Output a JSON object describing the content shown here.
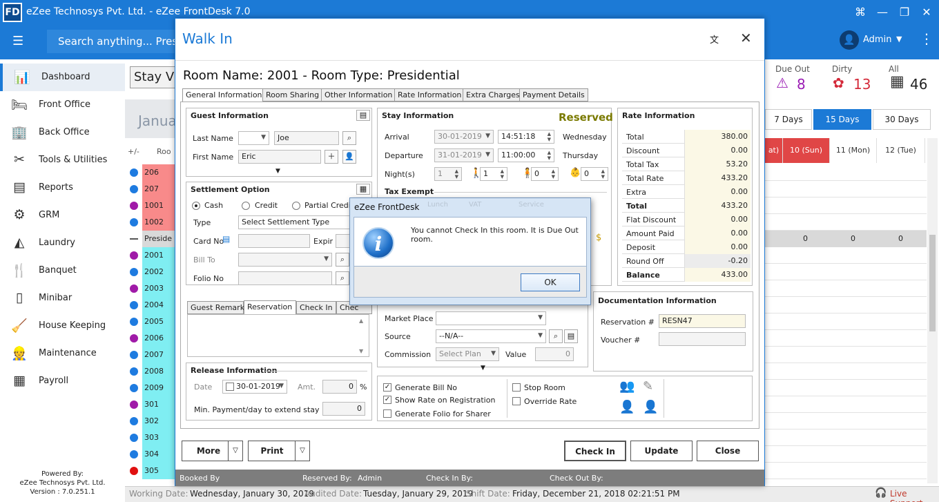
{
  "app": {
    "logo": "FD",
    "title": "eZee Technosys Pvt. Ltd. - eZee FrontDesk 7.0"
  },
  "topbar": {
    "search_placeholder": "Search anything... Press",
    "user": "Admin"
  },
  "sidebar": {
    "items": [
      {
        "label": "Dashboard",
        "icon": "chart-icon"
      },
      {
        "label": "Front Office",
        "icon": "bed-icon"
      },
      {
        "label": "Back Office",
        "icon": "building-icon"
      },
      {
        "label": "Tools & Utilities",
        "icon": "tools-icon"
      },
      {
        "label": "Reports",
        "icon": "report-icon"
      },
      {
        "label": "GRM",
        "icon": "grm-icon"
      },
      {
        "label": "Laundry",
        "icon": "iron-icon"
      },
      {
        "label": "Banquet",
        "icon": "cutlery-icon"
      },
      {
        "label": "Minibar",
        "icon": "fridge-icon"
      },
      {
        "label": "House Keeping",
        "icon": "broom-icon"
      },
      {
        "label": "Maintenance",
        "icon": "worker-icon"
      },
      {
        "label": "Payroll",
        "icon": "payroll-icon"
      }
    ],
    "powered": [
      "Powered By:",
      "eZee Technosys Pvt. Ltd.",
      "Version : 7.0.251.1"
    ]
  },
  "background": {
    "stay_view": "Stay Vie",
    "month": "Janua",
    "col_plusminus": "+/-",
    "col_room": "Roo",
    "stats": [
      {
        "label": "Due Out",
        "value": "8"
      },
      {
        "label": "Dirty",
        "value": "13"
      },
      {
        "label": "All",
        "value": "46"
      }
    ],
    "day_buttons": [
      "7 Days",
      "15 Days",
      "30 Days"
    ],
    "day_heads": [
      "at)",
      "10 (Sun)",
      "11 (Mon)",
      "12 (Tue)"
    ],
    "zero_row": [
      "0",
      "0",
      "0"
    ],
    "rooms": [
      {
        "num": "206",
        "dot": "#1e7be0",
        "bg": "#f88a8a"
      },
      {
        "num": "207",
        "dot": "#1e7be0",
        "bg": "#f88a8a"
      },
      {
        "num": "1001",
        "dot": "#a01aa8",
        "bg": "#f88a8a"
      },
      {
        "num": "1002",
        "dot": "#1e7be0",
        "bg": "#f88a8a"
      },
      {
        "num": "Preside",
        "dot": "",
        "bg": "#d9d9d9"
      },
      {
        "num": "2001",
        "dot": "#a01aa8",
        "bg": "#7feef2"
      },
      {
        "num": "2002",
        "dot": "#1e7be0",
        "bg": "#7feef2"
      },
      {
        "num": "2003",
        "dot": "#a01aa8",
        "bg": "#7feef2"
      },
      {
        "num": "2004",
        "dot": "#1e7be0",
        "bg": "#7feef2"
      },
      {
        "num": "2005",
        "dot": "#1e7be0",
        "bg": "#7feef2"
      },
      {
        "num": "2006",
        "dot": "#a01aa8",
        "bg": "#7feef2"
      },
      {
        "num": "2007",
        "dot": "#1e7be0",
        "bg": "#7feef2"
      },
      {
        "num": "2008",
        "dot": "#1e7be0",
        "bg": "#7feef2"
      },
      {
        "num": "2009",
        "dot": "#1e7be0",
        "bg": "#7feef2"
      },
      {
        "num": "301",
        "dot": "#a01aa8",
        "bg": "#7feef2"
      },
      {
        "num": "302",
        "dot": "#1e7be0",
        "bg": "#7feef2"
      },
      {
        "num": "303",
        "dot": "#1e7be0",
        "bg": "#7feef2"
      },
      {
        "num": "304",
        "dot": "#1e7be0",
        "bg": "#7feef2"
      },
      {
        "num": "305",
        "dot": "#e01010",
        "bg": "#7feef2"
      }
    ]
  },
  "status": {
    "working_label": "Working Date:",
    "working": "Wednesday, January 30, 2019",
    "audited_label": "Audited Date:",
    "audited": "Tuesday, January 29, 2019",
    "shift_label": "Shift Date:",
    "shift": "Friday, December 21, 2018 02:21:51 PM",
    "live_support": "Live Support"
  },
  "walkin": {
    "title": "Walk In",
    "room_name": "Room Name: 2001 - Room Type: Presidential",
    "tabs": [
      "General Information",
      "Room Sharing",
      "Other Information",
      "Rate Information",
      "Extra Charges",
      "Payment Details"
    ],
    "guest": {
      "header": "Guest Information",
      "last_name_label": "Last Name",
      "last_name": "Joe",
      "first_name_label": "First Name",
      "first_name": "Eric"
    },
    "settlement": {
      "header": "Settlement Option",
      "cash": "Cash",
      "credit": "Credit",
      "partial": "Partial Credit",
      "type_label": "Type",
      "type_value": "Select Settlement Type",
      "card_label": "Card No",
      "expiry_label": "Expir",
      "bill_to_label": "Bill To",
      "folio_label": "Folio No"
    },
    "remark_tabs": [
      "Guest Remark",
      "Reservation",
      "Check In",
      "Chec"
    ],
    "release": {
      "header": "Release Information",
      "date_label": "Date",
      "date": "30-01-2019",
      "amt_label": "Amt.",
      "amt": "0",
      "pct": "%",
      "min_label": "Min. Payment/day to extend stay",
      "min_val": "0"
    },
    "stay": {
      "header": "Stay Information",
      "status": "Reserved",
      "arrival_label": "Arrival",
      "arrival_date": "30-01-2019",
      "arrival_time": "14:51:18",
      "arrival_day": "Wednesday",
      "departure_label": "Departure",
      "departure_date": "31-01-2019",
      "departure_time": "11:00:00",
      "departure_day": "Thursday",
      "nights_label": "Night(s)",
      "nights": "1",
      "adults": "1",
      "children": "0",
      "infants": "0",
      "tax_exempt": "Tax Exempt"
    },
    "market": {
      "market_label": "Market Place",
      "source_label": "Source",
      "source": "--N/A--",
      "commission_label": "Commission",
      "commission": "Select Plan",
      "value_label": "Value",
      "value": "0"
    },
    "rate": {
      "header": "Rate Information",
      "rows": [
        {
          "label": "Total",
          "value": "380.00"
        },
        {
          "label": "Discount",
          "value": "0.00"
        },
        {
          "label": "Total Tax",
          "value": "53.20"
        },
        {
          "label": "Total Rate",
          "value": "433.20"
        },
        {
          "label": "Extra",
          "value": "0.00"
        },
        {
          "label": "Total",
          "value": "433.20"
        },
        {
          "label": "Flat Discount",
          "value": "0.00"
        },
        {
          "label": "Amount Paid",
          "value": "0.00"
        },
        {
          "label": "Deposit",
          "value": "0.00"
        },
        {
          "label": "Round Off",
          "value": "-0.20"
        },
        {
          "label": "Balance",
          "value": "433.00"
        }
      ]
    },
    "documentation": {
      "header": "Documentation Information",
      "reservation_label": "Reservation #",
      "reservation": "RESN47",
      "voucher_label": "Voucher #"
    },
    "options": {
      "generate_bill": "Generate Bill No",
      "show_rate": "Show Rate on Registration",
      "generate_folio": "Generate Folio for Sharer",
      "stop_room": "Stop Room",
      "override_rate": "Override Rate"
    },
    "buttons": {
      "more": "More",
      "print": "Print",
      "check_in": "Check In",
      "update": "Update",
      "close": "Close"
    },
    "footer": {
      "booked_by": "Booked By",
      "reserved_by": "Reserved By:",
      "reserved_by_value": "Admin",
      "check_in_by": "Check In By:",
      "check_out_by": "Check Out By:"
    }
  },
  "msgbox": {
    "title": "eZee FrontDesk",
    "message": "You cannot Check In this room. It is Due Out room.",
    "ok": "OK",
    "ghost": [
      "Lunch",
      "VAT",
      "Service"
    ]
  }
}
